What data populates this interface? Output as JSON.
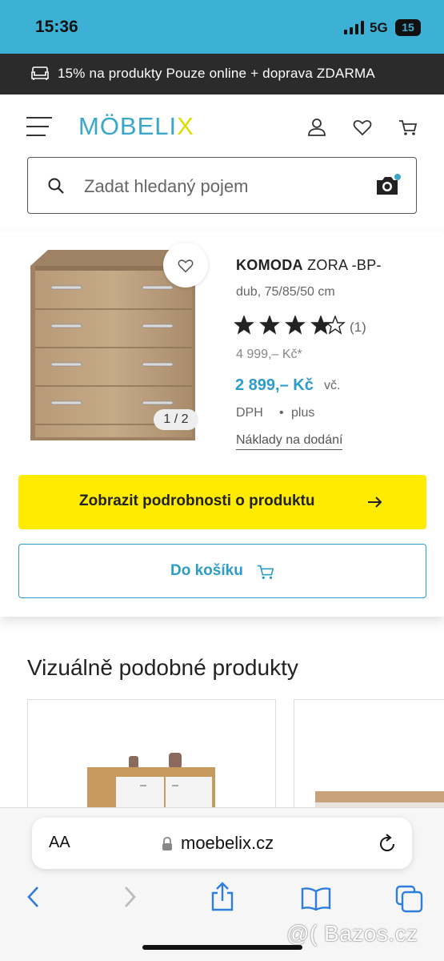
{
  "status_bar": {
    "time": "15:36",
    "network": "5G",
    "battery": "15"
  },
  "promo": {
    "text": "15% na produkty Pouze online + doprava ZDARMA",
    "icon": "sofa-icon"
  },
  "header": {
    "logo": {
      "part1": "MÖBELI",
      "part2": "X"
    },
    "icons": [
      "menu-icon",
      "user-icon",
      "heart-icon",
      "cart-icon"
    ]
  },
  "search": {
    "placeholder": "Zadat hledaný pojem",
    "icon": "search-icon",
    "camera_icon": "camera-icon"
  },
  "product": {
    "brand": "KOMODA",
    "name": "ZORA -BP-",
    "variant": "dub, 75/85/50 cm",
    "rating": 4,
    "rating_max": 5,
    "rating_count": "(1)",
    "old_price": "4 999,– Kč*",
    "price": "2 899,– Kč",
    "incl": "vč.",
    "vat": "DPH",
    "bullet": "•",
    "plus": "plus",
    "delivery_link": "Náklady na dodání",
    "pager": "1 / 2"
  },
  "buttons": {
    "detail": "Zobrazit podrobnosti o produktu",
    "cart": "Do košíku"
  },
  "similar": {
    "title": "Vizuálně podobné produkty"
  },
  "safari": {
    "text_size": "AA",
    "url": "moebelix.cz"
  },
  "watermark": "@( Bazos.cz",
  "colors": {
    "accent": "#2c9ccb",
    "status_bar": "#3db0d6",
    "cta_yellow": "#ffeb00",
    "promo_bg": "#2b2b2b"
  }
}
